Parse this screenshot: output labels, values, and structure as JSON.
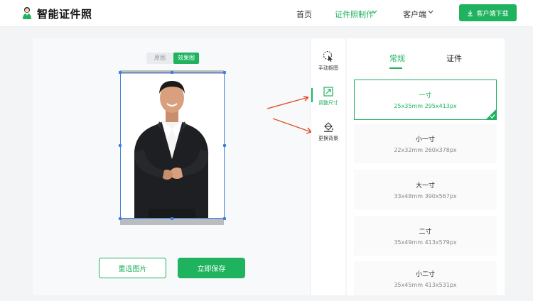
{
  "header": {
    "brand": "智能证件照",
    "nav": [
      {
        "label": "首页",
        "active": false
      },
      {
        "label": "证件照制作",
        "active": true
      },
      {
        "label": "客户端",
        "active": false
      }
    ],
    "download_label": "客户端下载"
  },
  "canvas": {
    "toggle_original": "原图",
    "toggle_effect": "效果图",
    "reselect_label": "重选图片",
    "save_label": "立即保存"
  },
  "tools": [
    {
      "label": "手动抠图",
      "icon": "cursor-select-icon",
      "active": false
    },
    {
      "label": "调整尺寸",
      "icon": "resize-icon",
      "active": true
    },
    {
      "label": "更换背景",
      "icon": "paint-bucket-icon",
      "active": false
    }
  ],
  "size_tabs": [
    {
      "label": "常规",
      "active": true
    },
    {
      "label": "证件",
      "active": false
    }
  ],
  "sizes": [
    {
      "name": "一寸",
      "dims": "25x35mm 295x413px",
      "selected": true
    },
    {
      "name": "小一寸",
      "dims": "22x32mm 260x378px",
      "selected": false
    },
    {
      "name": "大一寸",
      "dims": "33x48mm 390x567px",
      "selected": false
    },
    {
      "name": "二寸",
      "dims": "35x49mm 413x579px",
      "selected": false
    },
    {
      "name": "小二寸",
      "dims": "35x45mm 413x531px",
      "selected": false
    }
  ],
  "colors": {
    "accent": "#1fb35f",
    "crop_frame": "#3b7de0",
    "arrow": "#e0502a"
  }
}
